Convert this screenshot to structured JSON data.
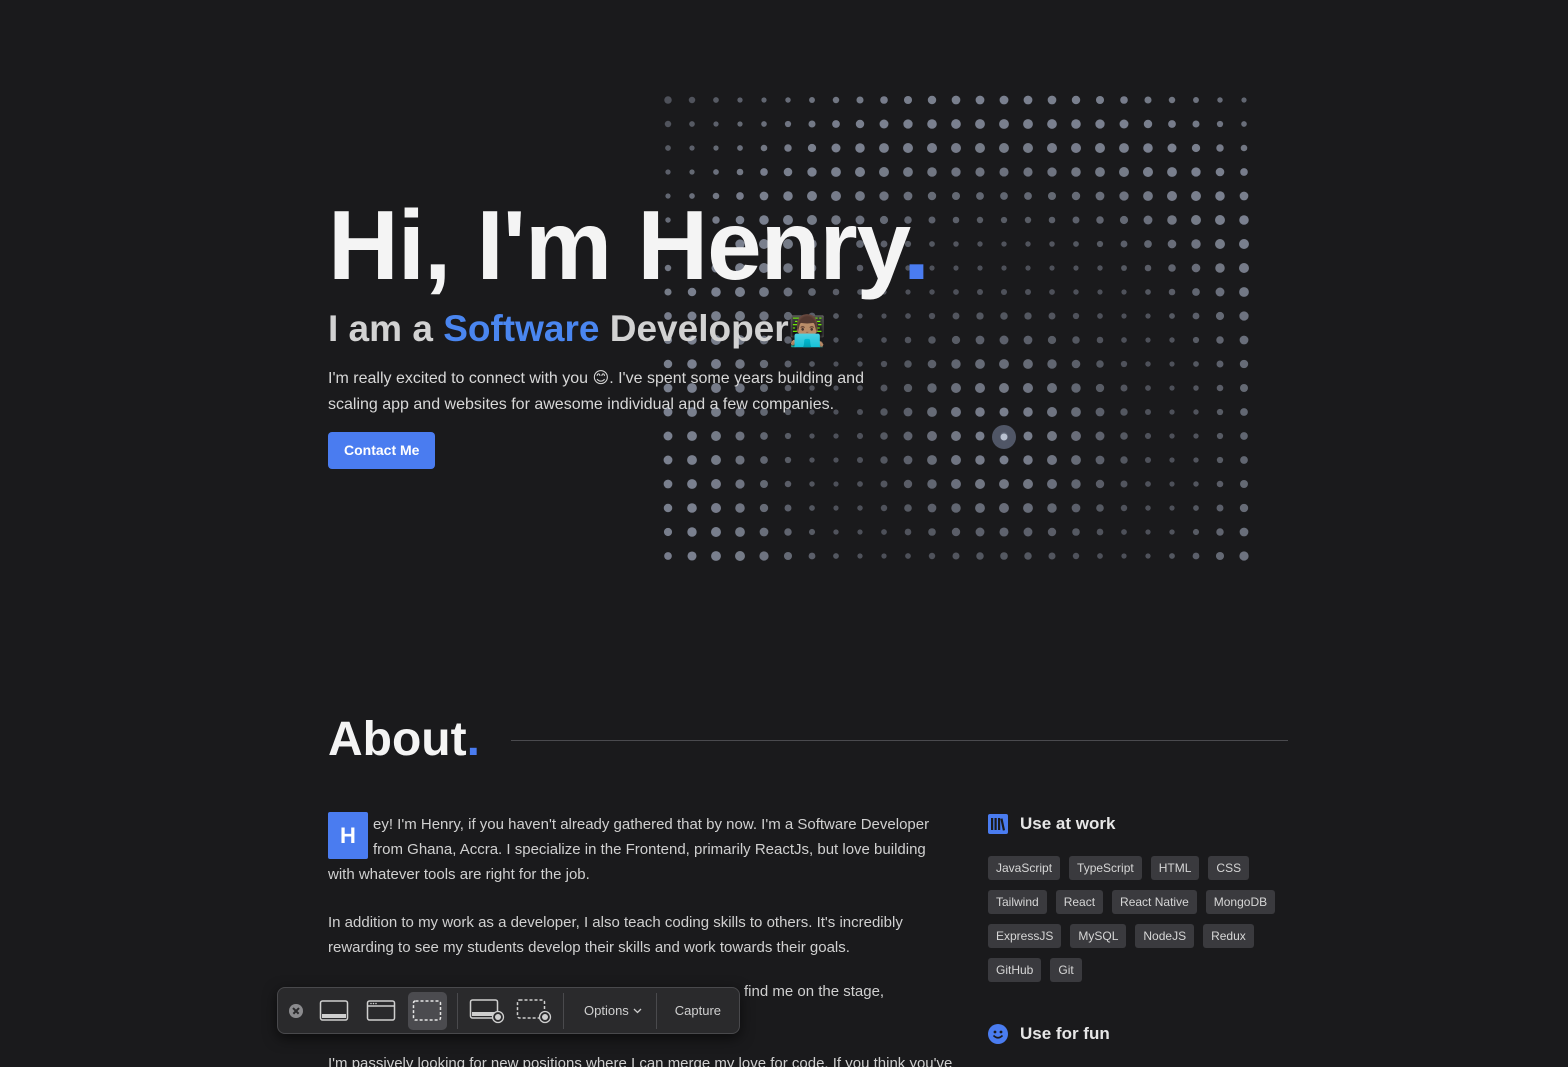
{
  "hero": {
    "title": "Hi, I'm Henry",
    "title_dot": ".",
    "subtitle_prefix": "I am a",
    "subtitle_accent": "Software",
    "subtitle_suffix": "Developer",
    "subtitle_emoji": "👨🏽‍💻",
    "description_part1": "I'm really excited to connect with you",
    "description_emoji": "😊",
    "description_part2": ". I've spent some years building and scaling app and websites for awesome individual and a few companies.",
    "cta_label": "Contact Me"
  },
  "about": {
    "title": "About",
    "title_dot": ".",
    "dropcap": "H",
    "para1": "ey! I'm Henry, if you haven't already gathered that by now. I'm a Software Developer from Ghana, Accra. I specialize in the Frontend, primarily ReactJs, but love building with whatever tools are right for the job.",
    "para2": "In addition to my work as a developer, I also teach coding skills to others. It's incredibly rewarding to see my students develop their skills and work towards their goals.",
    "para3_visible": "find me on the stage,",
    "para4_visible": "I'm passively looking for new positions where I can merge my love for code. If you think you've"
  },
  "work_tools": {
    "heading": "Use at work",
    "items": [
      "JavaScript",
      "TypeScript",
      "HTML",
      "CSS",
      "Tailwind",
      "React",
      "React Native",
      "MongoDB",
      "ExpressJS",
      "MySQL",
      "NodeJS",
      "Redux",
      "GitHub",
      "Git"
    ]
  },
  "fun_tools": {
    "heading": "Use for fun"
  },
  "toolbar": {
    "options_label": "Options",
    "capture_label": "Capture",
    "icons": [
      "close-icon",
      "capture-entire-screen-icon",
      "capture-window-icon",
      "capture-selection-icon",
      "record-screen-icon",
      "record-selection-icon"
    ]
  },
  "colors": {
    "accent": "#4a7cf0",
    "background": "#1a1a1c",
    "chip_bg": "#3a3a3e"
  }
}
